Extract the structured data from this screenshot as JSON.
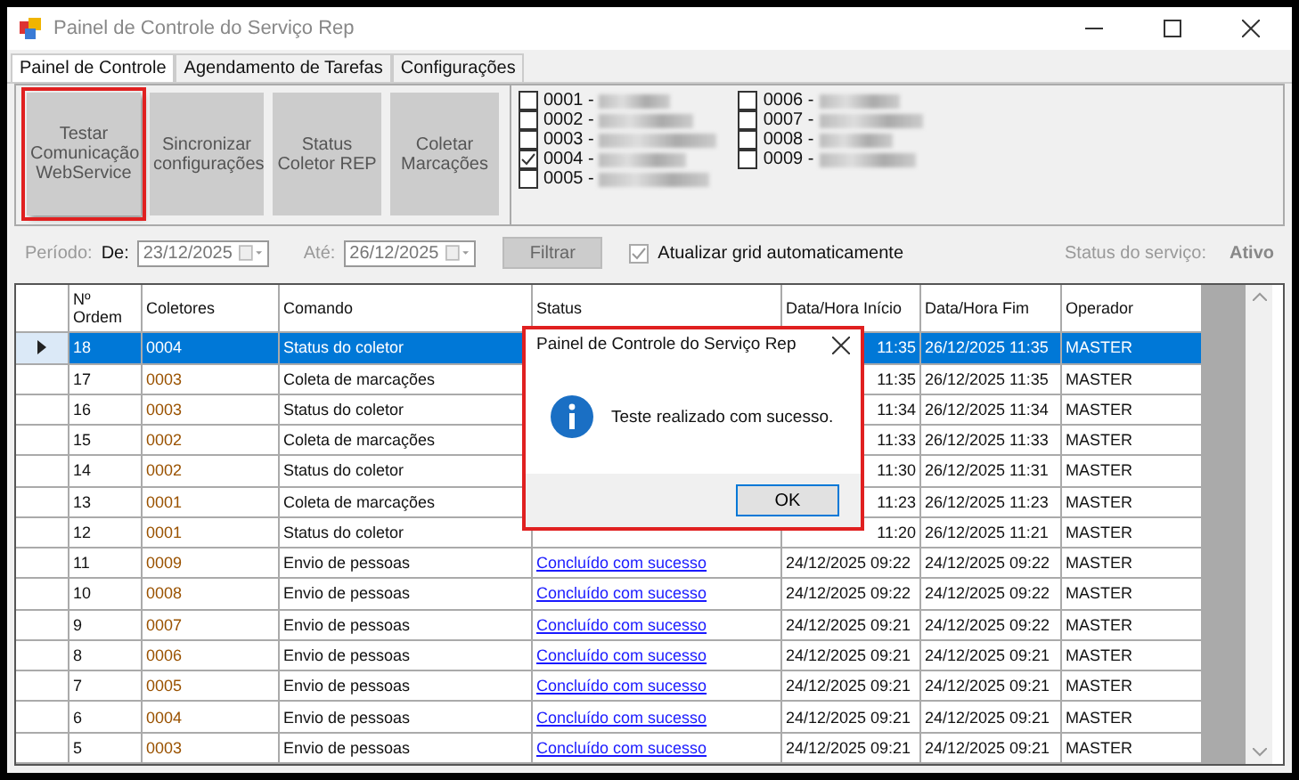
{
  "window": {
    "title": "Painel de Controle do Serviço Rep"
  },
  "tabs": [
    {
      "label": "Painel de Controle",
      "selected": true
    },
    {
      "label": "Agendamento de Tarefas",
      "selected": false
    },
    {
      "label": "Configurações",
      "selected": false
    }
  ],
  "action_buttons": [
    {
      "label": "Testar Comunicação WebService",
      "highlighted": true
    },
    {
      "label": "Sincronizar configurações",
      "highlighted": false
    },
    {
      "label": "Status Coletor REP",
      "highlighted": false
    },
    {
      "label": "Coletar Marcações",
      "highlighted": false
    }
  ],
  "collectors": [
    {
      "code": "0001 -",
      "checked": false
    },
    {
      "code": "0002 -",
      "checked": false
    },
    {
      "code": "0003 -",
      "checked": false
    },
    {
      "code": "0004 -",
      "checked": true
    },
    {
      "code": "0005 -",
      "checked": false
    },
    {
      "code": "0006 -",
      "checked": false
    },
    {
      "code": "0007 -",
      "checked": false
    },
    {
      "code": "0008 -",
      "checked": false
    },
    {
      "code": "0009 -",
      "checked": false
    }
  ],
  "filter": {
    "period_label": "Período:",
    "from_label": "De:",
    "from_value": "23/12/2025",
    "to_label": "Até:",
    "to_value": "26/12/2025",
    "button": "Filtrar",
    "auto_refresh": {
      "label": "Atualizar grid automaticamente",
      "checked": true
    },
    "service_status_label": "Status do serviço:",
    "service_status": "Ativo"
  },
  "grid": {
    "columns": [
      "Nº Ordem",
      "Coletores",
      "Comando",
      "Status",
      "Data/Hora Início",
      "Data/Hora Fim",
      "Operador"
    ],
    "rows": [
      {
        "order": "18",
        "collector": "0004",
        "command": "Status do coletor",
        "start": "11:35",
        "end": "26/12/2025 11:35",
        "operator": "MASTER",
        "selected": true
      },
      {
        "order": "17",
        "collector": "0003",
        "command": "Coleta de marcações",
        "start": "11:35",
        "end": "26/12/2025 11:35",
        "operator": "MASTER",
        "selected": false
      },
      {
        "order": "16",
        "collector": "0003",
        "command": "Status do coletor",
        "start": "11:34",
        "end": "26/12/2025 11:34",
        "operator": "MASTER",
        "selected": false
      },
      {
        "order": "15",
        "collector": "0002",
        "command": "Coleta de marcações",
        "start": "11:33",
        "end": "26/12/2025 11:33",
        "operator": "MASTER",
        "selected": false
      },
      {
        "order": "14",
        "collector": "0002",
        "command": "Status do coletor",
        "start": "11:30",
        "end": "26/12/2025 11:31",
        "operator": "MASTER",
        "selected": false
      },
      {
        "order": "13",
        "collector": "0001",
        "command": "Coleta de marcações",
        "start": "11:23",
        "end": "26/12/2025 11:23",
        "operator": "MASTER",
        "selected": false
      },
      {
        "order": "12",
        "collector": "0001",
        "command": "Status do coletor",
        "start": "11:20",
        "end": "26/12/2025 11:21",
        "operator": "MASTER",
        "selected": false
      },
      {
        "order": "11",
        "collector": "0009",
        "command": "Envio de pessoas",
        "status": "Concluído com sucesso",
        "start": "24/12/2025 09:22",
        "end": "24/12/2025 09:22",
        "operator": "MASTER",
        "selected": false
      },
      {
        "order": "10",
        "collector": "0008",
        "command": "Envio de pessoas",
        "status": "Concluído com sucesso",
        "start": "24/12/2025 09:22",
        "end": "24/12/2025 09:22",
        "operator": "MASTER",
        "selected": false
      },
      {
        "order": "9",
        "collector": "0007",
        "command": "Envio de pessoas",
        "status": "Concluído com sucesso",
        "start": "24/12/2025 09:21",
        "end": "24/12/2025 09:22",
        "operator": "MASTER",
        "selected": false
      },
      {
        "order": "8",
        "collector": "0006",
        "command": "Envio de pessoas",
        "status": "Concluído com sucesso",
        "start": "24/12/2025 09:21",
        "end": "24/12/2025 09:21",
        "operator": "MASTER",
        "selected": false
      },
      {
        "order": "7",
        "collector": "0005",
        "command": "Envio de pessoas",
        "status": "Concluído com sucesso",
        "start": "24/12/2025 09:21",
        "end": "24/12/2025 09:21",
        "operator": "MASTER",
        "selected": false
      },
      {
        "order": "6",
        "collector": "0004",
        "command": "Envio de pessoas",
        "status": "Concluído com sucesso",
        "start": "24/12/2025 09:21",
        "end": "24/12/2025 09:21",
        "operator": "MASTER",
        "selected": false
      },
      {
        "order": "5",
        "collector": "0003",
        "command": "Envio de pessoas",
        "status": "Concluído com sucesso",
        "start": "24/12/2025 09:21",
        "end": "24/12/2025 09:21",
        "operator": "MASTER",
        "selected": false
      }
    ]
  },
  "dialog": {
    "title": "Painel de Controle do Serviço Rep",
    "message": "Teste realizado com sucesso.",
    "ok_button": "OK",
    "highlighted": true
  }
}
